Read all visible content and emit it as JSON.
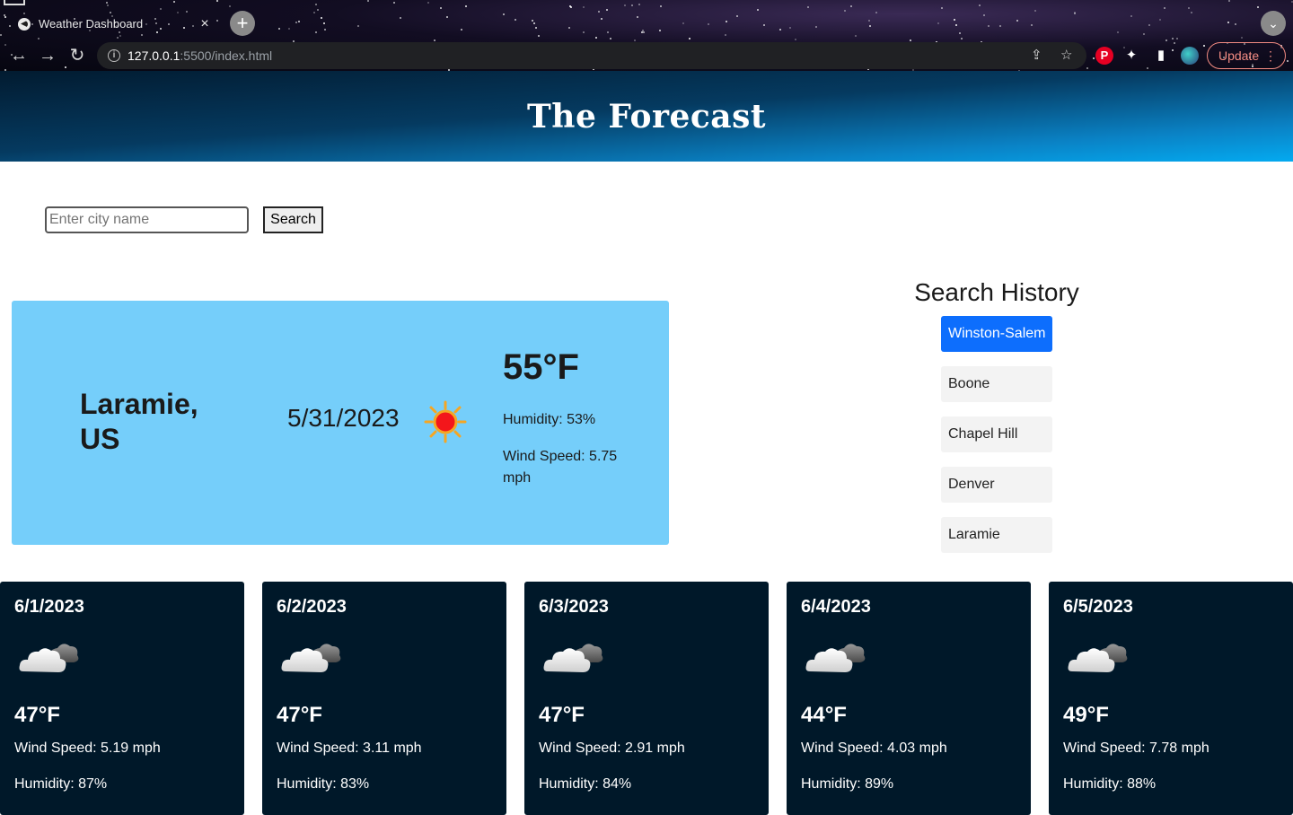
{
  "browser": {
    "tab_title": "Weather Dashboard",
    "tab_close": "×",
    "new_tab": "+",
    "url_host": "127.0.0.1",
    "url_path": ":5500/index.html",
    "update_label": "Update",
    "menu_dots": "⋮"
  },
  "header": {
    "title": "The Forecast"
  },
  "search": {
    "placeholder": "Enter city name",
    "button_label": "Search"
  },
  "current": {
    "city": "Laramie, US",
    "date": "5/31/2023",
    "icon": "sun-icon",
    "temp": "55°F",
    "humidity": "Humidity: 53%",
    "wind": "Wind Speed: 5.75 mph"
  },
  "history": {
    "title": "Search History",
    "items": [
      "Winston-Salem",
      "Boone",
      "Chapel Hill",
      "Denver",
      "Laramie"
    ]
  },
  "forecast": [
    {
      "date": "6/1/2023",
      "icon": "cloud-icon",
      "temp": "47°F",
      "wind": "Wind Speed: 5.19 mph",
      "humidity": "Humidity: 87%"
    },
    {
      "date": "6/2/2023",
      "icon": "cloud-icon",
      "temp": "47°F",
      "wind": "Wind Speed: 3.11 mph",
      "humidity": "Humidity: 83%"
    },
    {
      "date": "6/3/2023",
      "icon": "cloud-icon",
      "temp": "47°F",
      "wind": "Wind Speed: 2.91 mph",
      "humidity": "Humidity: 84%"
    },
    {
      "date": "6/4/2023",
      "icon": "cloud-icon",
      "temp": "44°F",
      "wind": "Wind Speed: 4.03 mph",
      "humidity": "Humidity: 89%"
    },
    {
      "date": "6/5/2023",
      "icon": "cloud-icon",
      "temp": "49°F",
      "wind": "Wind Speed: 7.78 mph",
      "humidity": "Humidity: 88%"
    }
  ],
  "colors": {
    "current_card": "#75cefa",
    "forecast_card": "#001829",
    "history_active": "#0d6efd",
    "header_dark": "#021b30",
    "header_light": "#04aaf0"
  }
}
